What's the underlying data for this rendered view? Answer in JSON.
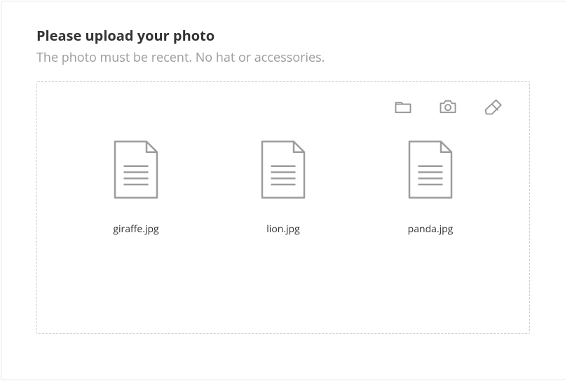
{
  "header": {
    "title": "Please upload your photo",
    "subtitle": "The photo must be recent. No hat or accessories."
  },
  "toolbar": {
    "browse": "folder-open-icon",
    "camera": "camera-icon",
    "erase": "eraser-icon"
  },
  "files": [
    {
      "name": "giraffe.jpg"
    },
    {
      "name": "lion.jpg"
    },
    {
      "name": "panda.jpg"
    }
  ]
}
